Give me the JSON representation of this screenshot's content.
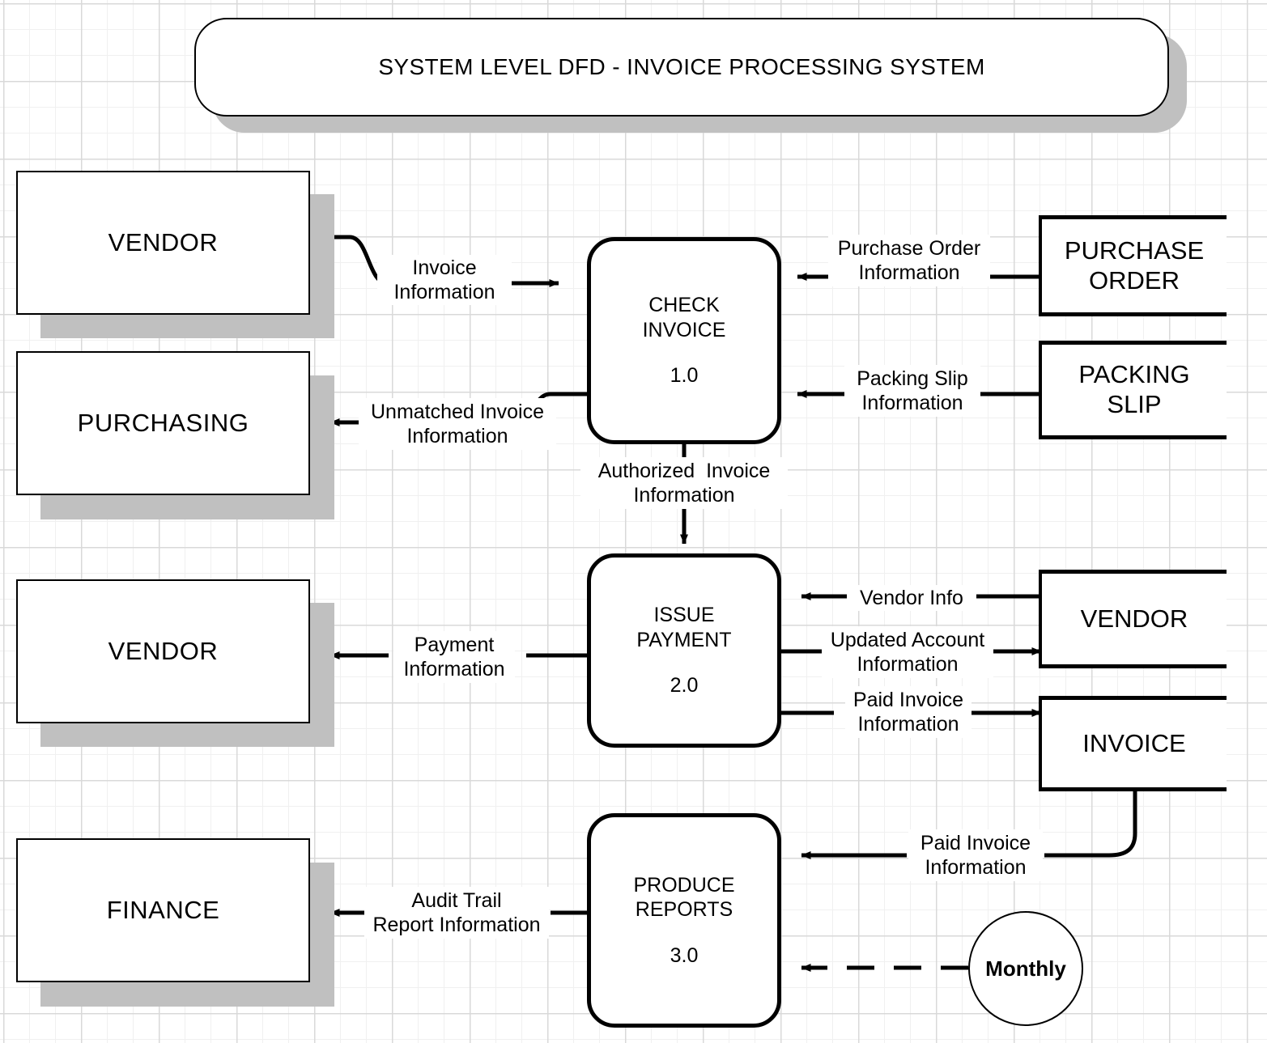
{
  "title": {
    "text": "SYSTEM LEVEL DFD - INVOICE PROCESSING SYSTEM"
  },
  "entities": [
    {
      "id": "vendor-top",
      "label": "VENDOR"
    },
    {
      "id": "purchasing",
      "label": "PURCHASING"
    },
    {
      "id": "vendor-mid",
      "label": "VENDOR"
    },
    {
      "id": "finance",
      "label": "FINANCE"
    }
  ],
  "processes": [
    {
      "id": "check-invoice",
      "name_line1": "CHECK",
      "name_line2": "INVOICE",
      "number": "1.0"
    },
    {
      "id": "issue-payment",
      "name_line1": "ISSUE",
      "name_line2": "PAYMENT",
      "number": "2.0"
    },
    {
      "id": "produce-reports",
      "name_line1": "PRODUCE",
      "name_line2": "REPORTS",
      "number": "3.0"
    }
  ],
  "data_stores": [
    {
      "id": "purchase-order",
      "line1": "PURCHASE",
      "line2": "ORDER"
    },
    {
      "id": "packing-slip",
      "line1": "PACKING",
      "line2": "SLIP"
    },
    {
      "id": "vendor-store",
      "line1": "VENDOR",
      "line2": ""
    },
    {
      "id": "invoice-store",
      "line1": "INVOICE",
      "line2": ""
    }
  ],
  "trigger": {
    "id": "monthly-trigger",
    "label": "Monthly"
  },
  "flows": [
    {
      "id": "invoice-information",
      "line1": "Invoice",
      "line2": "Information"
    },
    {
      "id": "purchase-order-information",
      "line1": "Purchase Order",
      "line2": "Information"
    },
    {
      "id": "packing-slip-information",
      "line1": "Packing Slip",
      "line2": "Information"
    },
    {
      "id": "unmatched-invoice-information",
      "line1": "Unmatched Invoice",
      "line2": "Information"
    },
    {
      "id": "authorized-invoice-information",
      "line1": "Authorized  Invoice",
      "line2": "Information"
    },
    {
      "id": "vendor-info",
      "line1": "Vendor Info",
      "line2": ""
    },
    {
      "id": "updated-account-information",
      "line1": "Updated Account",
      "line2": "Information"
    },
    {
      "id": "paid-invoice-information-store",
      "line1": "Paid Invoice",
      "line2": "Information"
    },
    {
      "id": "payment-information",
      "line1": "Payment",
      "line2": "Information"
    },
    {
      "id": "paid-invoice-information-report",
      "line1": "Paid Invoice",
      "line2": "Information"
    },
    {
      "id": "audit-trail-report-information",
      "line1": "Audit Trail",
      "line2": "Report Information"
    }
  ],
  "colors": {
    "stroke": "#000000",
    "shadow": "#c0c0c0",
    "background": "#ffffff",
    "grid_minor": "#f0f0f0",
    "grid_major": "#d9d9d9"
  }
}
